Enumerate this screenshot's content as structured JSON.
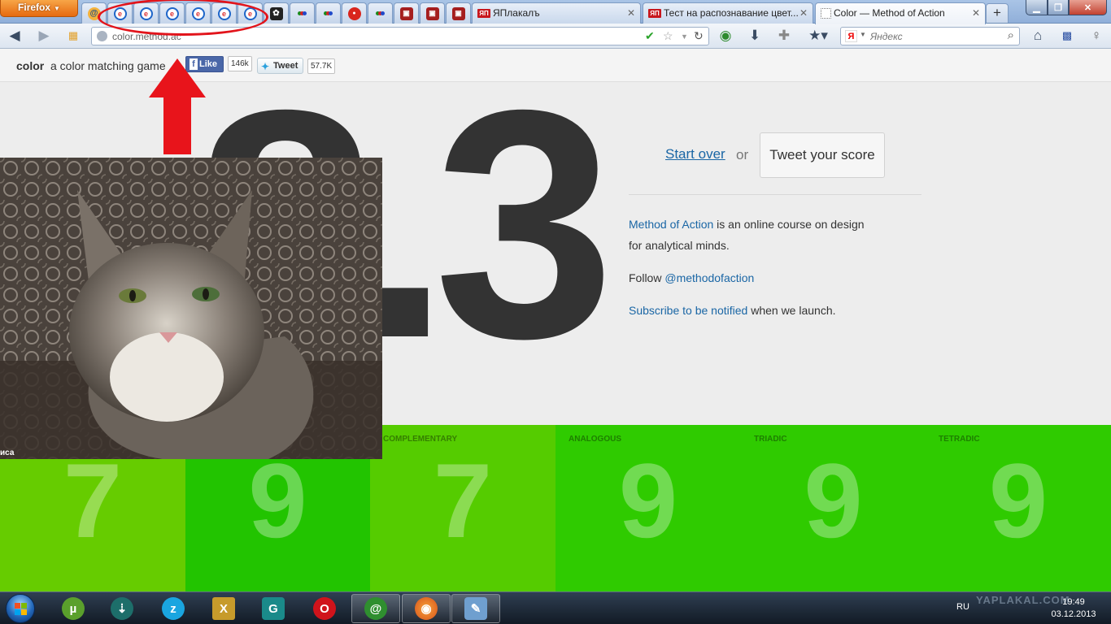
{
  "browser": {
    "menu_button": "Firefox",
    "tabs": [
      {
        "title": "ЯПлакалъ",
        "favicon": "ЯП"
      },
      {
        "title": "Тест на распознавание цвет...",
        "favicon": "ЯП"
      },
      {
        "title": "Color — Method of Action",
        "favicon": ""
      }
    ],
    "new_tab": "+",
    "url_value": "color.method.ac",
    "search_placeholder": "Яндекс",
    "search_engine": "Я",
    "colors": {
      "tabbar": "#a9c4e6",
      "firefox_button": "#e66a10",
      "close": "#c24131"
    }
  },
  "page": {
    "brand": "color",
    "tagline": "a color matching game",
    "fb_like": "Like",
    "fb_count": "146k",
    "tweet": "Tweet",
    "tweet_count": "57.7K",
    "score": "8.3",
    "start_over": "Start over",
    "or": "or",
    "tweet_score": "Tweet your score",
    "info": {
      "course_link": "Method of Action",
      "course_text": " is an online course on design",
      "course_text2": "for analytical minds.",
      "follow_text": "Follow ",
      "follow_link": "@methodofaction",
      "subscribe_link": "Subscribe to be notified",
      "subscribe_text": " when we launch."
    },
    "tiles": [
      {
        "label": "",
        "score": "7",
        "color": "#66cc00"
      },
      {
        "label": "",
        "score": "9",
        "color": "#22c400"
      },
      {
        "label": "COMPLEMENTARY",
        "score": "7",
        "color": "#55cc00"
      },
      {
        "label": "ANALOGOUS",
        "score": "9",
        "color": "#2fcb00"
      },
      {
        "label": "TRIADIC",
        "score": "9",
        "color": "#2fcb00"
      },
      {
        "label": "TETRADIC",
        "score": "9",
        "color": "#2fcb00"
      }
    ],
    "photo_caption": "иса"
  },
  "taskbar": {
    "language": "RU",
    "time": "19:49",
    "date": "03.12.2013",
    "watermark": "YAPLAKAL.COM"
  }
}
